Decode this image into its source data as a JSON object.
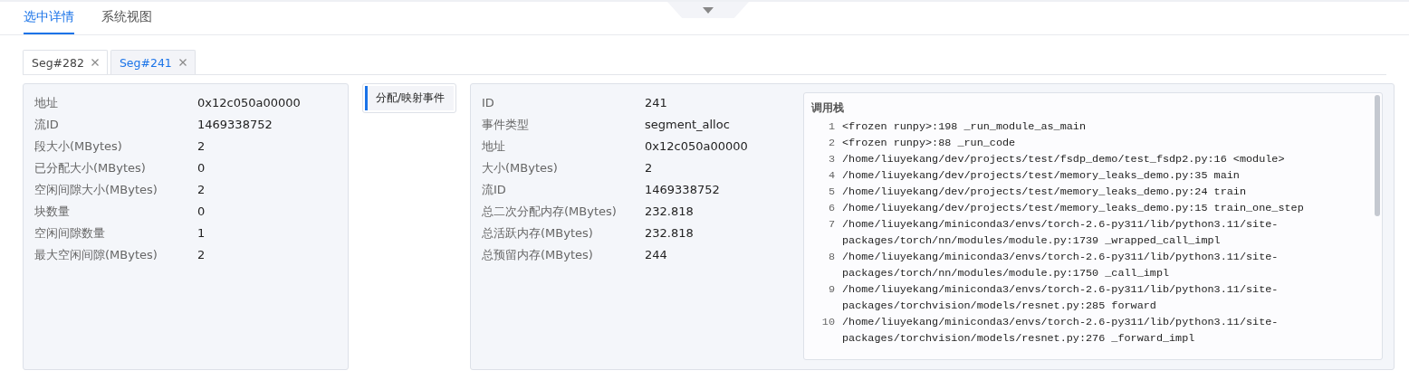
{
  "main_tabs": [
    {
      "label": "选中详情",
      "selected": true
    },
    {
      "label": "系统视图",
      "selected": false
    }
  ],
  "segment_tabs": [
    {
      "label": "Seg#282",
      "selected": false
    },
    {
      "label": "Seg#241",
      "selected": true
    }
  ],
  "segment_details": [
    {
      "label": "地址",
      "value": "0x12c050a00000"
    },
    {
      "label": "流ID",
      "value": "1469338752"
    },
    {
      "label": "段大小(MBytes)",
      "value": "2"
    },
    {
      "label": "已分配大小(MBytes)",
      "value": "0"
    },
    {
      "label": "空闲间隙大小(MBytes)",
      "value": "2"
    },
    {
      "label": "块数量",
      "value": "0"
    },
    {
      "label": "空闲间隙数量",
      "value": "1"
    },
    {
      "label": "最大空闲间隙(MBytes)",
      "value": "2"
    }
  ],
  "event_list": [
    {
      "label": "分配/映射事件",
      "selected": true
    }
  ],
  "event_details": [
    {
      "label": "ID",
      "value": "241"
    },
    {
      "label": "事件类型",
      "value": "segment_alloc"
    },
    {
      "label": "地址",
      "value": "0x12c050a00000"
    },
    {
      "label": "大小(MBytes)",
      "value": "2"
    },
    {
      "label": "流ID",
      "value": "1469338752"
    },
    {
      "label": "总二次分配内存(MBytes)",
      "value": "232.818"
    },
    {
      "label": "总活跃内存(MBytes)",
      "value": "232.818"
    },
    {
      "label": "总预留内存(MBytes)",
      "value": "244"
    }
  ],
  "call_stack": {
    "title": "调用栈",
    "frames": [
      {
        "number": "1",
        "text": "<frozen runpy>:198 _run_module_as_main"
      },
      {
        "number": "2",
        "text": "<frozen runpy>:88 _run_code"
      },
      {
        "number": "3",
        "text": "/home/liuyekang/dev/projects/test/fsdp_demo/test_fsdp2.py:16 <module>"
      },
      {
        "number": "4",
        "text": "/home/liuyekang/dev/projects/test/memory_leaks_demo.py:35 main"
      },
      {
        "number": "5",
        "text": "/home/liuyekang/dev/projects/test/memory_leaks_demo.py:24 train"
      },
      {
        "number": "6",
        "text": "/home/liuyekang/dev/projects/test/memory_leaks_demo.py:15 train_one_step"
      },
      {
        "number": "7",
        "text": "/home/liuyekang/miniconda3/envs/torch-2.6-py311/lib/python3.11/site-packages/torch/nn/modules/module.py:1739 _wrapped_call_impl"
      },
      {
        "number": "8",
        "text": "/home/liuyekang/miniconda3/envs/torch-2.6-py311/lib/python3.11/site-packages/torch/nn/modules/module.py:1750 _call_impl"
      },
      {
        "number": "9",
        "text": "/home/liuyekang/miniconda3/envs/torch-2.6-py311/lib/python3.11/site-packages/torchvision/models/resnet.py:285 forward"
      },
      {
        "number": "10",
        "text": "/home/liuyekang/miniconda3/envs/torch-2.6-py311/lib/python3.11/site-packages/torchvision/models/resnet.py:276 _forward_impl"
      }
    ]
  }
}
